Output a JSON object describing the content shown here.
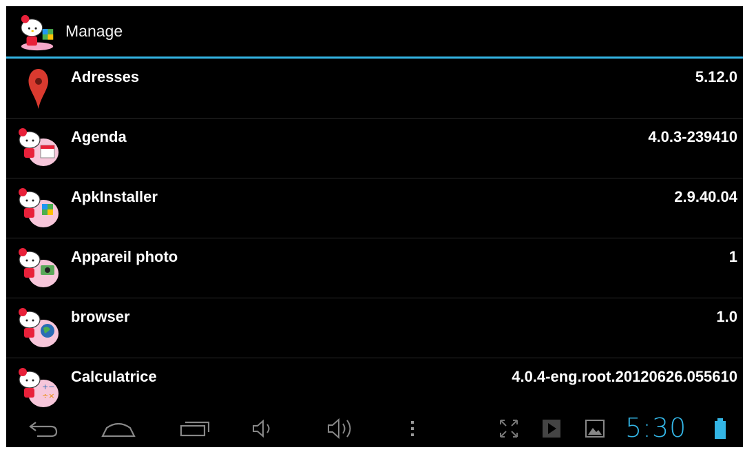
{
  "actionbar": {
    "title": "Manage",
    "icon": "kitty-apk-icon"
  },
  "apps": [
    {
      "name": "Adresses",
      "version": "5.12.0",
      "icon": "map-pin-icon"
    },
    {
      "name": "Agenda",
      "version": "4.0.3-239410",
      "icon": "kitty-calendar-icon"
    },
    {
      "name": "ApkInstaller",
      "version": "2.9.40.04",
      "icon": "kitty-apk-icon"
    },
    {
      "name": "Appareil photo",
      "version": "1",
      "icon": "kitty-camera-icon"
    },
    {
      "name": "browser",
      "version": "1.0",
      "icon": "kitty-globe-icon"
    },
    {
      "name": "Calculatrice",
      "version": "4.0.4-eng.root.20120626.055610",
      "icon": "kitty-calculator-icon"
    }
  ],
  "statusbar": {
    "time": "5:30"
  },
  "colors": {
    "accent": "#33b5e5",
    "background": "#000000",
    "text": "#ffffff"
  }
}
